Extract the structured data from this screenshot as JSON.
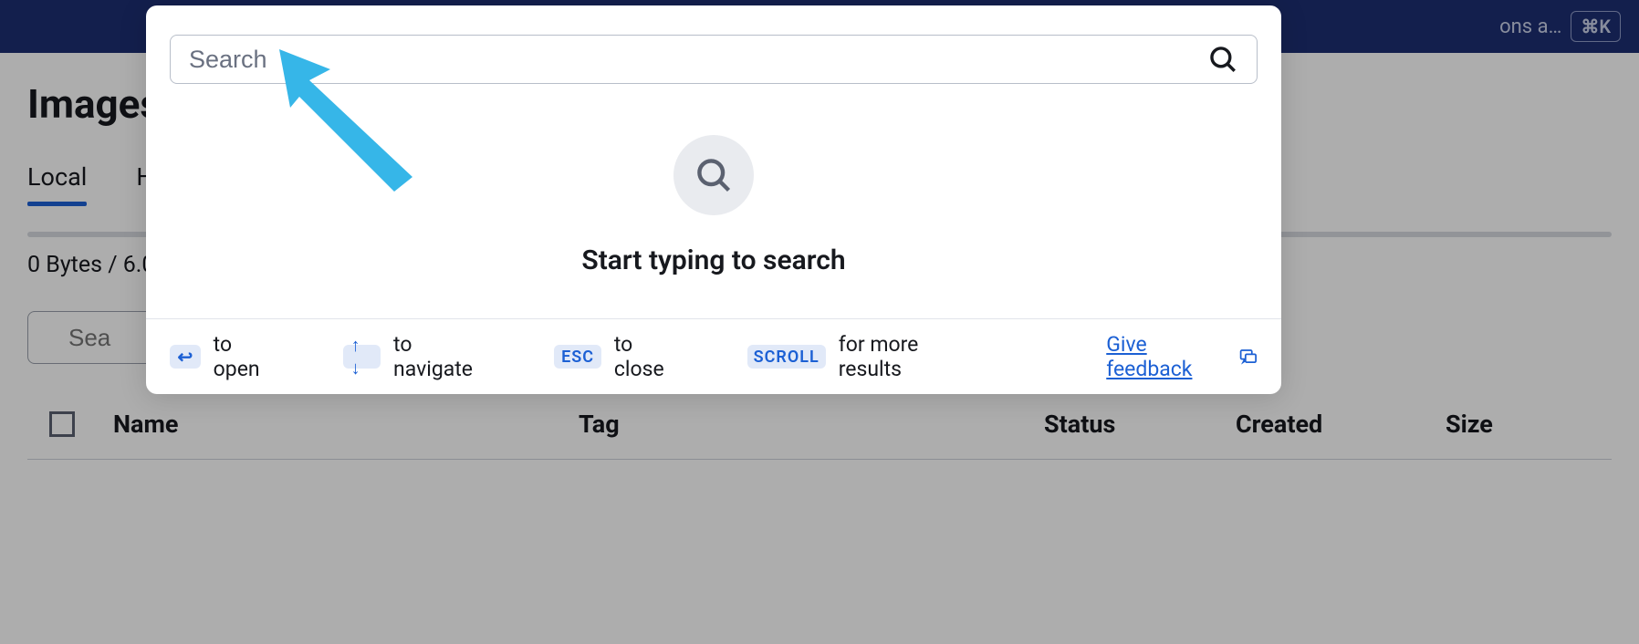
{
  "header": {
    "right_text": "ons a…",
    "shortcut": "⌘K"
  },
  "page": {
    "title": "Images",
    "tabs": {
      "local": "Local",
      "hub": "H"
    },
    "storage_text": "0 Bytes / 6.0",
    "bg_search_placeholder": "Sea",
    "columns": {
      "name": "Name",
      "tag": "Tag",
      "status": "Status",
      "created": "Created",
      "size": "Size"
    }
  },
  "modal": {
    "search_placeholder": "Search",
    "empty_text": "Start typing to search",
    "hints": {
      "open": "to open",
      "navigate": "to navigate",
      "close": "to close",
      "more": "for more results",
      "enter_key": "↩",
      "arrows_key": "↑ ↓",
      "esc_key": "ESC",
      "scroll_key": "SCROLL"
    },
    "feedback": "Give feedback"
  }
}
